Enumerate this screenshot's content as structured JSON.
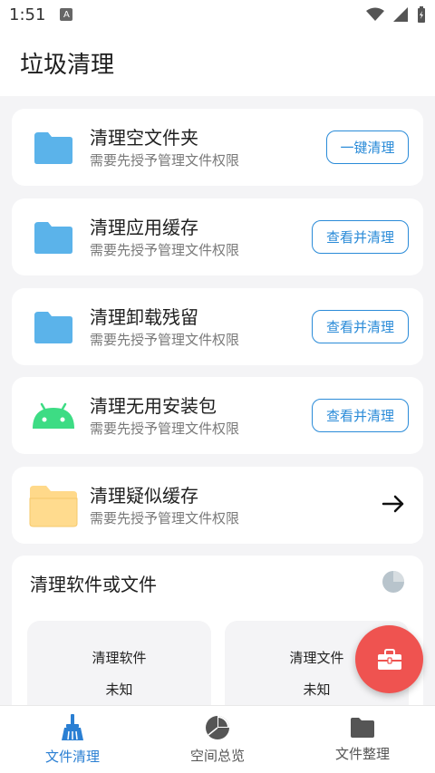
{
  "status": {
    "time": "1:51",
    "badge": "A"
  },
  "header": {
    "title": "垃圾清理"
  },
  "cards": [
    {
      "name": "清理空文件夹",
      "sub": "需要先授予管理文件权限",
      "button": "一键清理",
      "icon": "folder-icon"
    },
    {
      "name": "清理应用缓存",
      "sub": "需要先授予管理文件权限",
      "button": "查看并清理",
      "icon": "folder-icon"
    },
    {
      "name": "清理卸载残留",
      "sub": "需要先授予管理文件权限",
      "button": "查看并清理",
      "icon": "folder-icon"
    },
    {
      "name": "清理无用安装包",
      "sub": "需要先授予管理文件权限",
      "button": "查看并清理",
      "icon": "android-icon"
    },
    {
      "name": "清理疑似缓存",
      "sub": "需要先授予管理文件权限",
      "icon": "open-folder-icon"
    }
  ],
  "section": {
    "title": "清理软件或文件",
    "tiles": [
      {
        "label": "清理软件",
        "value": "未知"
      },
      {
        "label": "清理文件",
        "value": "未知"
      }
    ]
  },
  "nav": [
    {
      "label": "文件清理",
      "icon": "broom-icon"
    },
    {
      "label": "空间总览",
      "icon": "pie-chart-icon"
    },
    {
      "label": "文件整理",
      "icon": "folder-icon"
    }
  ],
  "colors": {
    "accent": "#2a8bd8",
    "fab": "#ef5350",
    "folder": "#5bb3ea",
    "android": "#3ddc84"
  }
}
